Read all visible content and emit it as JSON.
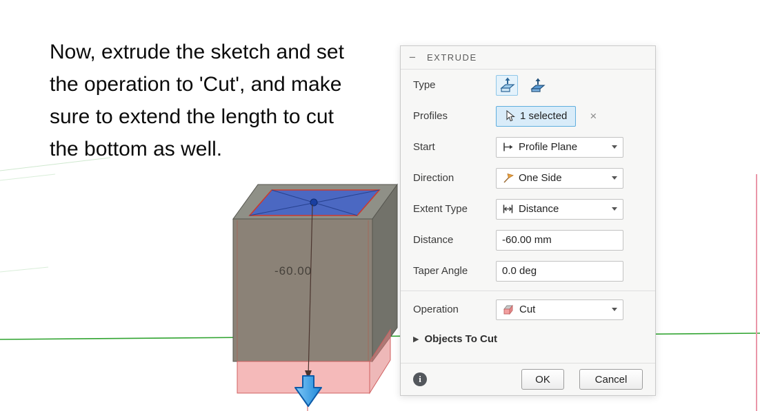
{
  "instruction": {
    "lines": [
      "Now, extrude the sketch and set",
      "the operation to 'Cut', and make",
      "sure to extend the length to cut",
      "the bottom as well."
    ]
  },
  "viewport": {
    "dimension_label": "-60.00"
  },
  "dialog": {
    "title": "EXTRUDE",
    "type": {
      "label": "Type"
    },
    "profiles": {
      "label": "Profiles",
      "value": "1 selected"
    },
    "start": {
      "label": "Start",
      "value": "Profile Plane"
    },
    "direction": {
      "label": "Direction",
      "value": "One Side"
    },
    "extent_type": {
      "label": "Extent Type",
      "value": "Distance"
    },
    "distance": {
      "label": "Distance",
      "value": "-60.00 mm"
    },
    "taper_angle": {
      "label": "Taper Angle",
      "value": "0.0 deg"
    },
    "operation": {
      "label": "Operation",
      "value": "Cut"
    },
    "objects_to_cut": {
      "label": "Objects To Cut"
    },
    "footer": {
      "ok": "OK",
      "cancel": "Cancel"
    }
  },
  "icons": {
    "collapse": "−",
    "clear": "×",
    "expander": "▶",
    "info": "i"
  },
  "colors": {
    "selection_blue": "#5faede",
    "selection_fill": "#d9ecf9",
    "sketch_blue": "#3c5fd0",
    "cut_pink": "#f0a0a0",
    "axis_green": "#2fa32f",
    "manipulator_blue": "#2e9df0"
  }
}
